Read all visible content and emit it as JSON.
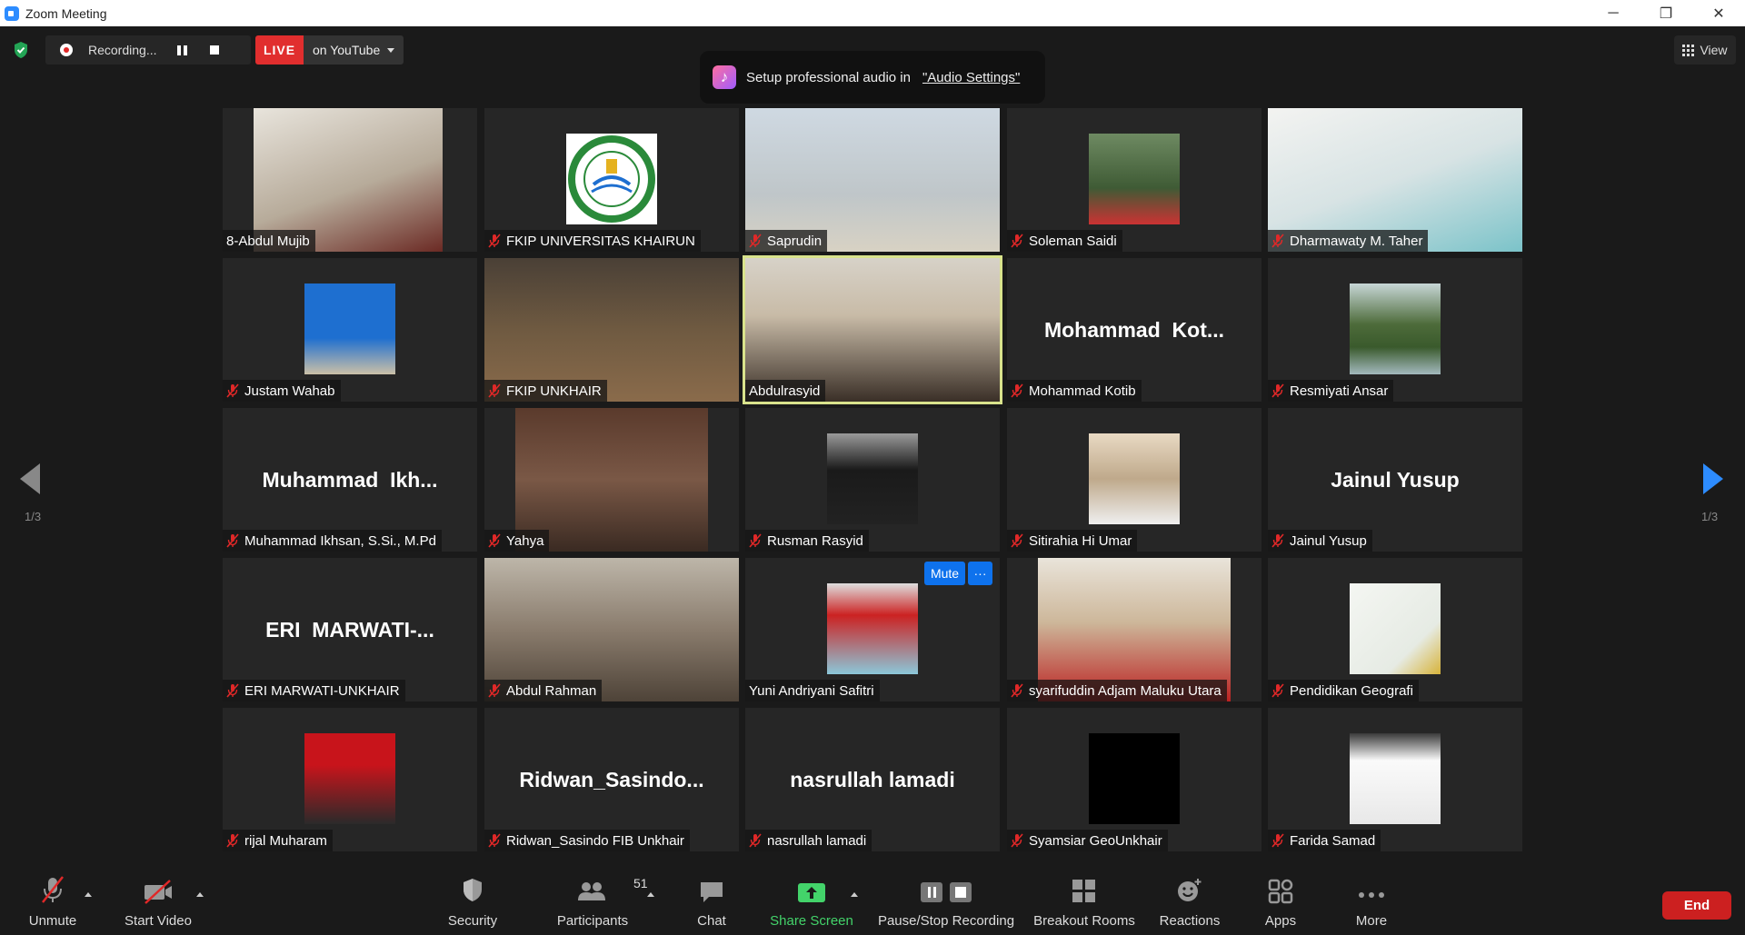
{
  "window": {
    "title": "Zoom Meeting",
    "controls": {
      "minimize": "─",
      "restore": "❐",
      "close": "✕"
    }
  },
  "topbar": {
    "recording_label": "Recording...",
    "live_label": "LIVE",
    "live_target": "on YouTube",
    "view_label": "View"
  },
  "banner": {
    "text": "Setup professional audio in",
    "link": "\"Audio Settings\""
  },
  "pagination": {
    "left": "1/3",
    "right": "1/3"
  },
  "participants": [
    {
      "name": "8-Abdul Mujib",
      "muted": false,
      "kind": "video",
      "big": ""
    },
    {
      "name": "FKIP UNIVERSITAS KHAIRUN",
      "muted": true,
      "kind": "logo",
      "big": ""
    },
    {
      "name": "Saprudin",
      "muted": true,
      "kind": "video",
      "big": ""
    },
    {
      "name": "Soleman Saidi",
      "muted": true,
      "kind": "photo",
      "big": ""
    },
    {
      "name": "Dharmawaty M. Taher",
      "muted": true,
      "kind": "video",
      "big": ""
    },
    {
      "name": "Justam Wahab",
      "muted": true,
      "kind": "photo",
      "big": ""
    },
    {
      "name": "FKIP UNKHAIR",
      "muted": true,
      "kind": "video",
      "big": ""
    },
    {
      "name": "Abdulrasyid",
      "muted": false,
      "kind": "video",
      "big": "",
      "active": true
    },
    {
      "name": "Mohammad Kotib",
      "muted": true,
      "kind": "text",
      "big": "Mohammad  Kot..."
    },
    {
      "name": "Resmiyati Ansar",
      "muted": true,
      "kind": "photo",
      "big": ""
    },
    {
      "name": "Muhammad Ikhsan, S.Si., M.Pd",
      "muted": true,
      "kind": "text",
      "big": "Muhammad  Ikh..."
    },
    {
      "name": "Yahya",
      "muted": true,
      "kind": "video",
      "big": ""
    },
    {
      "name": "Rusman Rasyid",
      "muted": true,
      "kind": "photo",
      "big": ""
    },
    {
      "name": "Sitirahia Hi Umar",
      "muted": true,
      "kind": "photo",
      "big": ""
    },
    {
      "name": "Jainul Yusup",
      "muted": true,
      "kind": "text",
      "big": "Jainul Yusup"
    },
    {
      "name": "ERI MARWATI-UNKHAIR",
      "muted": true,
      "kind": "text",
      "big": "ERI  MARWATI-..."
    },
    {
      "name": "Abdul Rahman",
      "muted": true,
      "kind": "video",
      "big": ""
    },
    {
      "name": "Yuni Andriyani Safitri",
      "muted": false,
      "kind": "photo",
      "big": "",
      "hover": true
    },
    {
      "name": "syarifuddin Adjam Maluku Utara",
      "muted": true,
      "kind": "video",
      "big": ""
    },
    {
      "name": "Pendidikan Geografi",
      "muted": true,
      "kind": "photo",
      "big": ""
    },
    {
      "name": "rijal Muharam",
      "muted": true,
      "kind": "photo",
      "big": ""
    },
    {
      "name": "Ridwan_Sasindo FIB Unkhair",
      "muted": true,
      "kind": "text",
      "big": "Ridwan_Sasindo..."
    },
    {
      "name": "nasrullah lamadi",
      "muted": true,
      "kind": "text",
      "big": "nasrullah lamadi"
    },
    {
      "name": "Syamsiar GeoUnkhair",
      "muted": true,
      "kind": "photo",
      "big": ""
    },
    {
      "name": "Farida Samad",
      "muted": true,
      "kind": "photo",
      "big": ""
    }
  ],
  "hover_controls": {
    "mute": "Mute",
    "more": "···"
  },
  "toolbar": {
    "unmute": "Unmute",
    "start_video": "Start Video",
    "security": "Security",
    "participants": "Participants",
    "participants_count": "51",
    "chat": "Chat",
    "share_screen": "Share Screen",
    "pause_stop": "Pause/Stop Recording",
    "breakout": "Breakout Rooms",
    "reactions": "Reactions",
    "apps": "Apps",
    "more": "More",
    "end": "End"
  },
  "colors": {
    "accent": "#2d8cff",
    "live": "#e12e2e",
    "share": "#43d36a",
    "end": "#cc2020",
    "active_speaker": "#d9e38c",
    "muted_icon": "#e02828"
  }
}
